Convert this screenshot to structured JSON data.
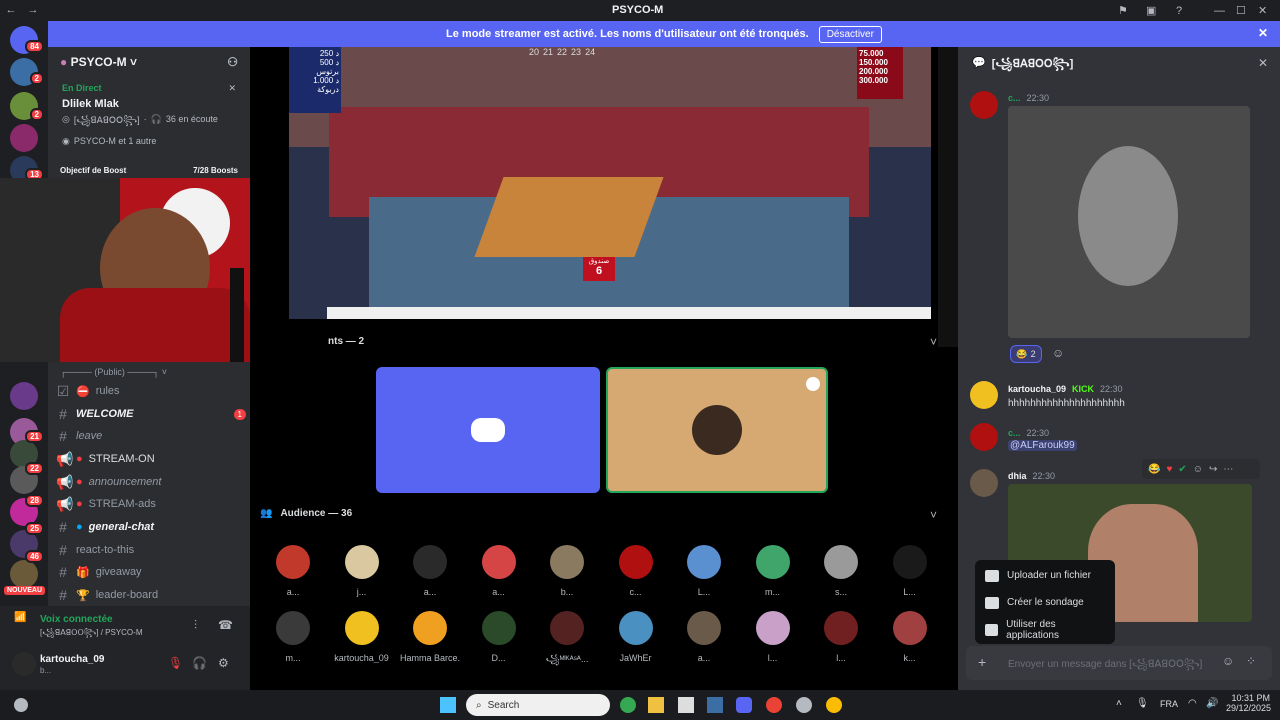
{
  "window": {
    "title": "PSYCO-M"
  },
  "banner": {
    "text": "Le mode streamer est activé. Les noms d'utilisateur ont été tronqués.",
    "button": "Désactiver"
  },
  "guild_badges": [
    "84",
    "2",
    "2",
    "13",
    "21",
    "22",
    "28",
    "25",
    "46",
    "NOUVEAU"
  ],
  "server": {
    "name": "PSYCO-M"
  },
  "live": {
    "status": "En Direct",
    "title": "Dlilek Mlak",
    "stage_name": "[꧁ꓭꓮꓭꓳꓳ꧂]",
    "listeners": "36 en écoute",
    "viewers": "PSYCO-M et 1 autre"
  },
  "boost": {
    "label": "Objectif de Boost",
    "count": "7/28 Boosts"
  },
  "category": {
    "label": "(Public)"
  },
  "channels": [
    {
      "name": "rules",
      "icon": "checkbox-icon",
      "italic": false
    },
    {
      "name": "WELCOME",
      "icon": "hash-icon",
      "italic": true,
      "badge": "1"
    },
    {
      "name": "leave",
      "icon": "hash-icon",
      "italic": true
    },
    {
      "name": "STREAM-ON",
      "icon": "megaphone-icon",
      "italic": false
    },
    {
      "name": "announcement",
      "icon": "megaphone-icon",
      "italic": true
    },
    {
      "name": "STREAM-ads",
      "icon": "megaphone-icon",
      "italic": false
    },
    {
      "name": "general-chat",
      "icon": "hash-icon",
      "italic": true
    },
    {
      "name": "react-to-this",
      "icon": "hash-icon",
      "italic": false
    },
    {
      "name": "giveaway",
      "icon": "hash-icon",
      "italic": false
    },
    {
      "name": "leader-board",
      "icon": "hash-icon",
      "italic": false
    }
  ],
  "voice": {
    "status": "Voix connectée",
    "location": "[꧁ꓭꓮꓭꓳꓳ꧂] / PSYCO-M"
  },
  "user": {
    "name": "kartoucha_09",
    "tag": "b..."
  },
  "tv": {
    "prizes_left": [
      "250 د",
      "500 د",
      "برتوس",
      "1.000 د",
      "دربوكة"
    ],
    "prizes_right": [
      "75.000",
      "150.000",
      "200.000",
      "300.000"
    ],
    "numbers": [
      "20",
      "21",
      "22",
      "23",
      "24"
    ],
    "box_label": "صندوق",
    "box_number": "6"
  },
  "speakers": {
    "label": "nts — 2"
  },
  "audience": {
    "label": "Audience — 36",
    "row1": [
      "a...",
      "j...",
      "a...",
      "a...",
      "b...",
      "c...",
      "L...",
      "m...",
      "s...",
      "L..."
    ],
    "row2": [
      "m...",
      "kartoucha_09",
      "Hamma Barce...",
      "D...",
      "꧁ᴹᴵᴷᴬˢᴬ...",
      "JaWhEr",
      "a...",
      "l...",
      "l...",
      "k..."
    ],
    "colors": [
      "#c0392b",
      "#d9c8a0",
      "#2a2a2a",
      "#d64545",
      "#8a7a60",
      "#b01010",
      "#5a8fd0",
      "#3fa56b",
      "#9a9a9a",
      "#1a1a1a",
      "#3a3a3a",
      "#f0c020",
      "#f0a020",
      "#2a4a2a",
      "#552222",
      "#4a90c0",
      "#6a5a4a",
      "#c8a0c8",
      "#702020",
      "#a04040"
    ]
  },
  "chat": {
    "stage_title": "[꧁ꓭꓮꓭꓳꓳ꧂]",
    "messages": [
      {
        "author": "c...",
        "time": "22:30",
        "content": ""
      },
      {
        "author": "kartoucha_09",
        "time": "22:30",
        "tag": "KICK",
        "content": "hhhhhhhhhhhhhhhhhhhhh"
      },
      {
        "author": "c...",
        "time": "22:30",
        "content": "@ALFarouk99"
      },
      {
        "author": "dhia",
        "time": "22:30",
        "content": ""
      }
    ],
    "reaction_count": "2",
    "composer_placeholder": "Envoyer un message dans [꧁ꓭꓮꓭꓳꓳ꧂]"
  },
  "context_menu": {
    "items": [
      "Uploader un fichier",
      "Créer le sondage",
      "Utiliser des applications"
    ]
  },
  "taskbar": {
    "search": "Search",
    "lang": "FRA",
    "time": "10:31 PM",
    "date": "29/12/2025"
  }
}
